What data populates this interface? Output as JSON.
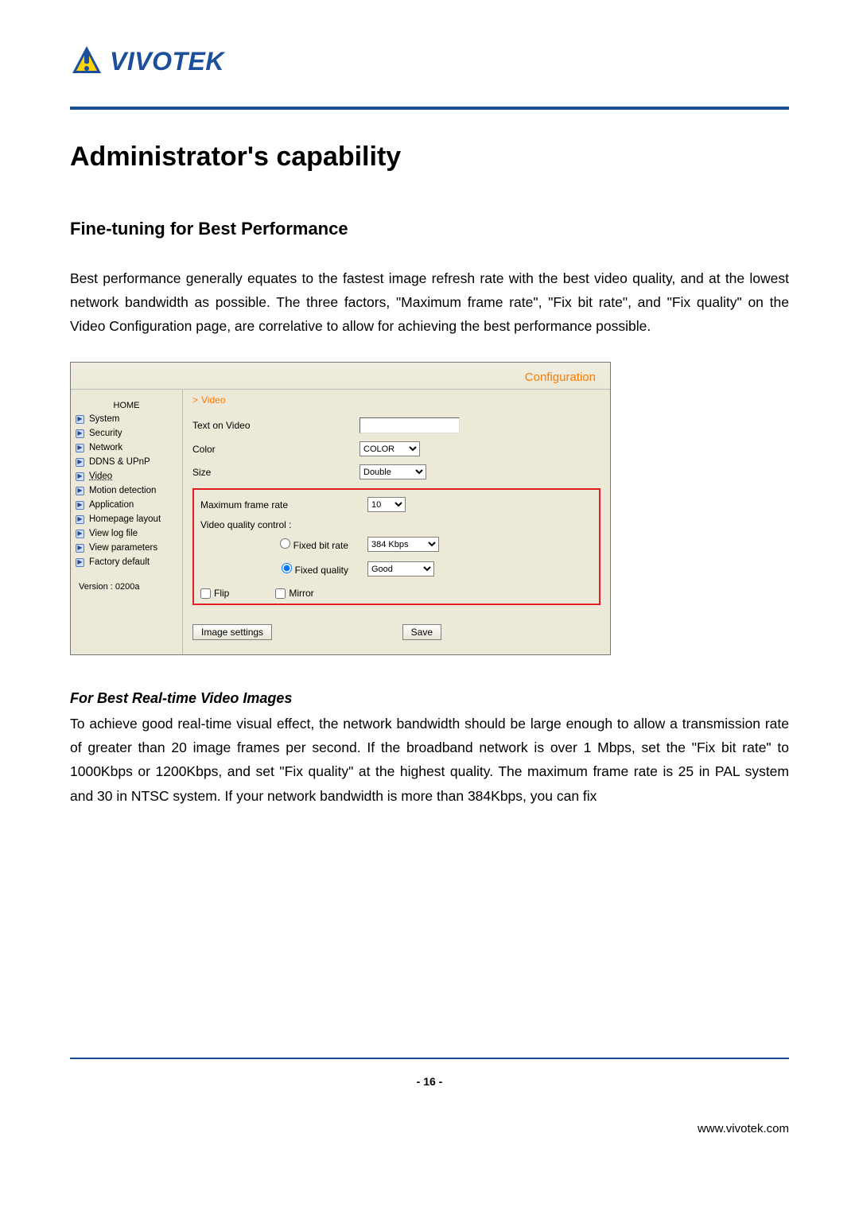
{
  "logo_text": "VIVOTEK",
  "h1": "Administrator's capability",
  "h2": "Fine-tuning for Best Performance",
  "intro": "Best performance generally equates to the fastest image refresh rate with the best video quality, and at the lowest network bandwidth as possible. The three factors, \"Maximum frame rate\", \"Fix bit rate\", and \"Fix quality\" on the Video Configuration page, are correlative to allow for achieving the best performance possible.",
  "config": {
    "header": "Configuration",
    "breadcrumb_prefix": ">",
    "breadcrumb": "Video",
    "sidebar": {
      "home": "HOME",
      "items": [
        "System",
        "Security",
        "Network",
        "DDNS & UPnP",
        "Video",
        "Motion detection",
        "Application",
        "Homepage layout",
        "View log file",
        "View parameters",
        "Factory default"
      ],
      "version": "Version : 0200a"
    },
    "labels": {
      "text_on_video": "Text on Video",
      "color": "Color",
      "size": "Size",
      "max_frame_rate": "Maximum frame rate",
      "video_quality": "Video quality control :",
      "fixed_bit_rate": "Fixed bit rate",
      "fixed_quality": "Fixed quality",
      "flip": "Flip",
      "mirror": "Mirror"
    },
    "values": {
      "text_on_video": "",
      "color": "COLOR",
      "size": "Double",
      "frame_rate": "10",
      "bit_rate": "384 Kbps",
      "quality": "Good"
    },
    "buttons": {
      "image_settings": "Image settings",
      "save": "Save"
    }
  },
  "h3": "For Best Real-time Video Images",
  "para2": "To achieve good real-time visual effect, the network bandwidth should be large enough to allow a transmission rate of greater than 20 image frames per second. If the broadband network is over 1 Mbps, set the \"Fix bit rate\" to 1000Kbps or 1200Kbps, and set \"Fix quality\" at the highest quality. The maximum frame rate is 25 in PAL system and 30 in NTSC system. If your network bandwidth is more than 384Kbps, you can fix",
  "page_number": "- 16 -",
  "footer_url": "www.vivotek.com"
}
